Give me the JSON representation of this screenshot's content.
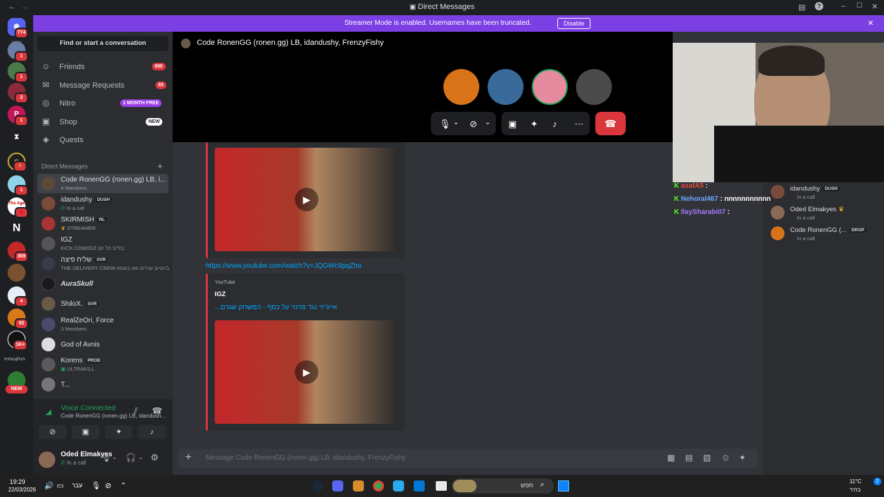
{
  "window": {
    "title": "Direct Messages"
  },
  "banner": {
    "message": "Streamer Mode is enabled. Usernames have been truncated.",
    "disable": "Disable"
  },
  "rail_badges": {
    "home": "774",
    "s1": "1",
    "s2": "1",
    "s3": "3",
    "s4": "1",
    "s6": "8",
    "s7": "1",
    "s8": "1",
    "s10": "369",
    "s12": "4",
    "s13": "92",
    "s14": "1K+",
    "new": "NEW"
  },
  "rail_labels": {
    "age": "The Age",
    "p": "P",
    "n": "N",
    "hebrew": "הכלקבעתית"
  },
  "sidebar": {
    "search": "Find or start a conversation",
    "nav": [
      {
        "label": "Friends",
        "pill": "690"
      },
      {
        "label": "Message Requests",
        "pill": "83"
      },
      {
        "label": "Nitro",
        "pill": "1 MONTH FREE"
      },
      {
        "label": "Shop",
        "pill": "NEW"
      },
      {
        "label": "Quests",
        "pill": ""
      }
    ],
    "dm_header": "Direct Messages",
    "dms": [
      {
        "name": "Code RonenGG (ronen.gg) LB, i...",
        "sub": "4 Members",
        "tag": ""
      },
      {
        "name": "idandushy",
        "sub": "In a call",
        "tag": "DUSH"
      },
      {
        "name": "SKIRMISH",
        "sub": "STREAMER",
        "tag": "RL"
      },
      {
        "name": "IGZ",
        "sub": "KICK.COM/IGZ בלייב כל יום",
        "tag": ""
      },
      {
        "name": "שליח פיצה",
        "sub": "THE DELIVERY CREW ביוטיוב שירים וואו באמא",
        "tag": "SVR"
      },
      {
        "name": "AuraSkull",
        "sub": "",
        "tag": ""
      },
      {
        "name": "ShiloX.",
        "sub": "",
        "tag": "SVR"
      },
      {
        "name": "RealZeOri, Force",
        "sub": "3 Members",
        "tag": ""
      },
      {
        "name": "God of Avnis",
        "sub": "",
        "tag": ""
      },
      {
        "name": "Korens",
        "sub": "ULTRAKILL",
        "tag": "PROD"
      },
      {
        "name": "T...",
        "sub": "",
        "tag": ""
      }
    ]
  },
  "voice": {
    "status": "Voice Connected",
    "channel": "Code RonenGG (ronen.gg) LB, idandush..."
  },
  "user": {
    "name": "Oded Elmakyes",
    "status": "In a call"
  },
  "call": {
    "title": "Code RonenGG (ronen.gg) LB, idandushy, FrenzyFishy"
  },
  "messages": {
    "url": "https://www.youtube.com/watch?v=JQGWc9pqZho",
    "provider": "YouTube",
    "author": "IGZ",
    "video_title": "אייג'יזי נגד פרנזי על כסף - המשחק שגרם..."
  },
  "composer": {
    "placeholder": "Message Code RonenGG (ronen.gg) LB, idandushy, FrenzyFishy"
  },
  "overlay_chat": [
    {
      "user": "asafA5",
      "msg": ""
    },
    {
      "user": "Nehoral467",
      "msg": "nnnnnnnnnnn"
    },
    {
      "user": "IlaySharabi07",
      "msg": ""
    }
  ],
  "members": [
    {
      "name": "idandushy",
      "sub": "In a call",
      "tag": "DUSH"
    },
    {
      "name": "Oded Elmakyes",
      "sub": "In a call",
      "tag": ""
    },
    {
      "name": "Code RonenGG (...",
      "sub": "In a call",
      "tag": "DROP"
    }
  ],
  "taskbar": {
    "time": "19:29",
    "date": "22/03/2026",
    "lang": "עבר",
    "search": "חפש",
    "weather": "11°C",
    "weather_sub": "בהיר",
    "notif": "2"
  },
  "colors": {
    "accent": "#5865f2",
    "banner": "#7b3fe4",
    "danger": "#da373c",
    "link": "#00a8fc"
  }
}
